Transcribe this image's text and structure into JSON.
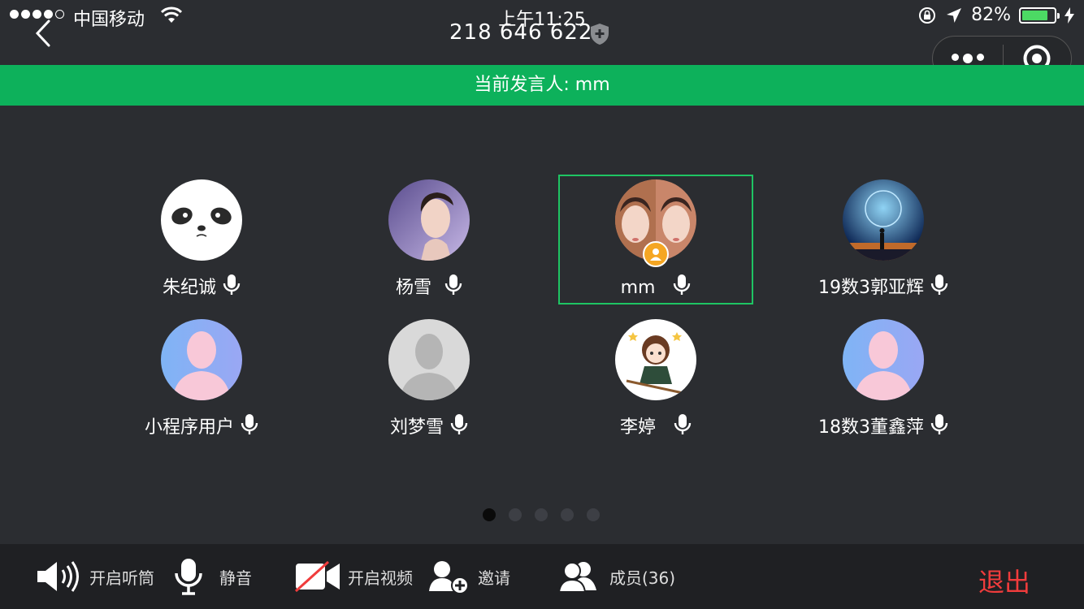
{
  "status_bar": {
    "carrier": "中国移动",
    "time": "上午11:25",
    "battery": "82%",
    "battery_level": 0.82
  },
  "header": {
    "meeting_id": "218 646 622"
  },
  "speaker_banner": "当前发言人: mm",
  "members": [
    {
      "name": "朱纪诚",
      "avatar": "panda-avatar"
    },
    {
      "name": "杨雪",
      "avatar": "woman-photo-avatar"
    },
    {
      "name": "mm",
      "avatar": "two-faces-avatar",
      "active": true,
      "host": true
    },
    {
      "name": "19数3郭亚辉",
      "avatar": "night-sky-avatar"
    },
    {
      "name": "小程序用户",
      "avatar": "default-blue-avatar"
    },
    {
      "name": "刘梦雪",
      "avatar": "default-gray-avatar"
    },
    {
      "name": "李婷",
      "avatar": "cartoon-girl-avatar"
    },
    {
      "name": "18数3董鑫萍",
      "avatar": "default-blue-avatar"
    }
  ],
  "pager": {
    "count": 5,
    "current": 1
  },
  "toolbar": {
    "speaker_label": "开启听筒",
    "mute_label": "静音",
    "video_label": "开启视频",
    "invite_label": "邀请",
    "members_label": "成员(36)",
    "exit_label": "退出"
  },
  "colors": {
    "accent": "#0db15b",
    "exit": "#f03c3c",
    "host_badge": "#f5a623"
  }
}
